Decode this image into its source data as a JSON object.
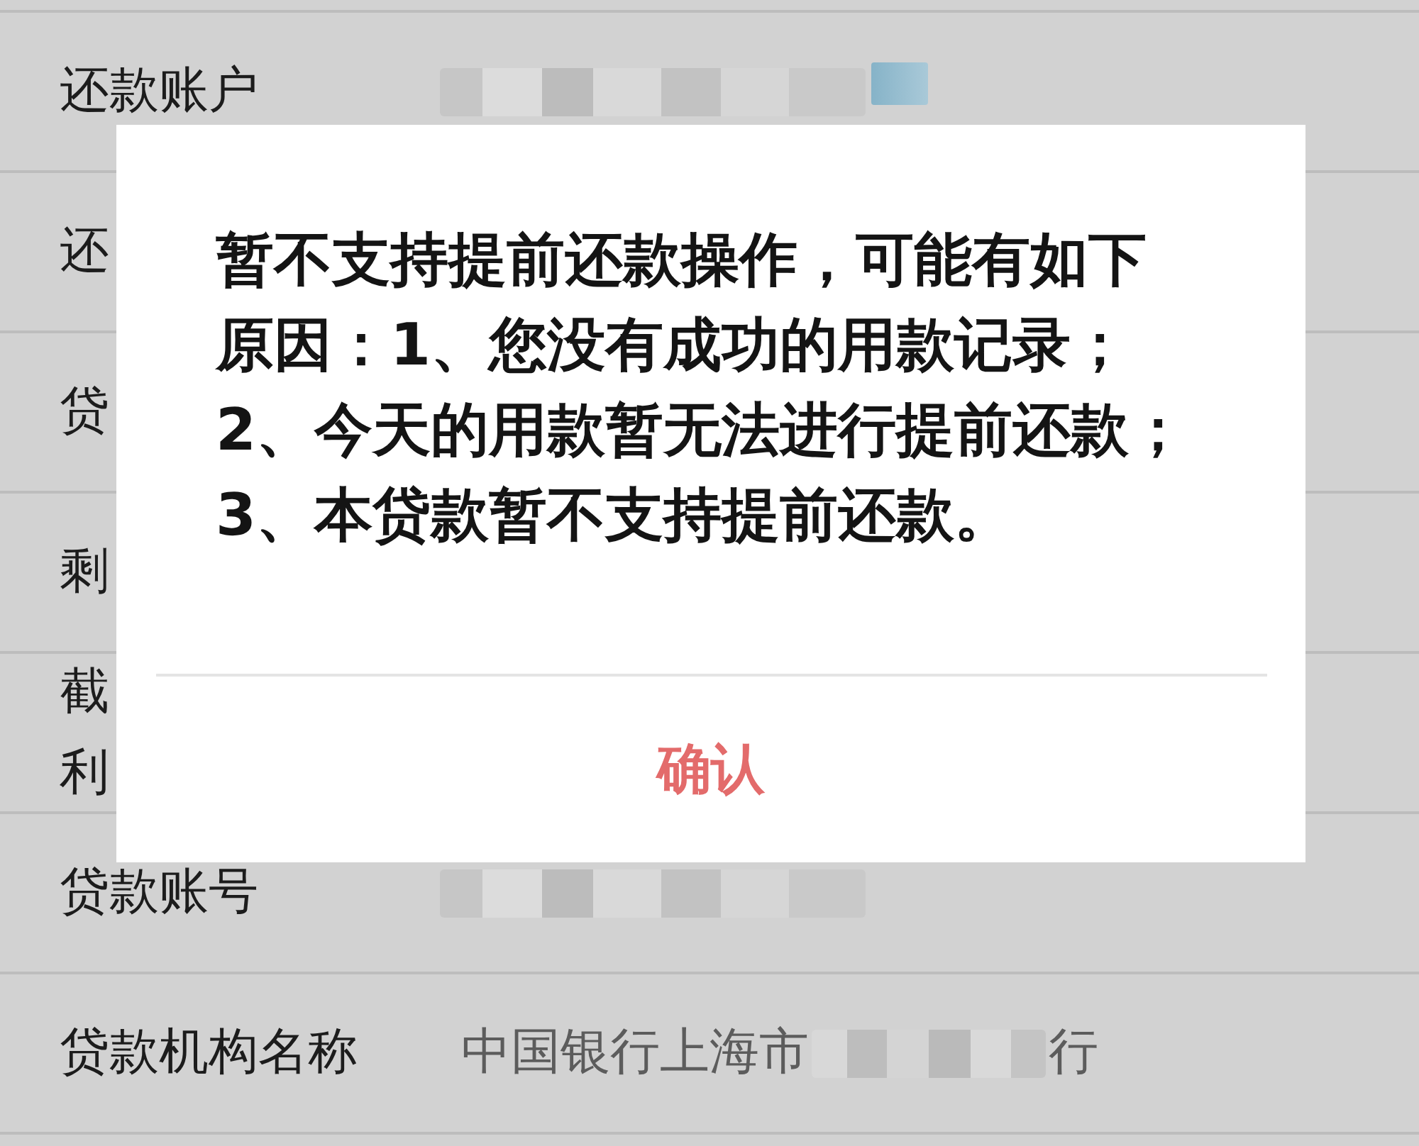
{
  "rows": [
    {
      "label": "还款账户",
      "value": [
        {
          "kind": "blurred"
        },
        {
          "kind": "blurred_link"
        }
      ]
    },
    {
      "label": "还"
    },
    {
      "label": "贷"
    },
    {
      "label": "剩"
    },
    {
      "label": [
        "截",
        "利"
      ]
    },
    {
      "label": "贷款账号",
      "value": [
        {
          "kind": "blurred"
        }
      ]
    },
    {
      "label": "贷款机构名称",
      "value": [
        {
          "kind": "text",
          "text": "中国银行上海市"
        },
        {
          "kind": "blurred"
        },
        {
          "kind": "text",
          "text": "行"
        }
      ]
    }
  ],
  "dialog": {
    "message": "暂不支持提前还款操作，可能有如下原因：1、您没有成功的用款记录；\n2、今天的用款暂无法进行提前还款；\n3、本贷款暂不支持提前还款。",
    "button": "确认"
  }
}
